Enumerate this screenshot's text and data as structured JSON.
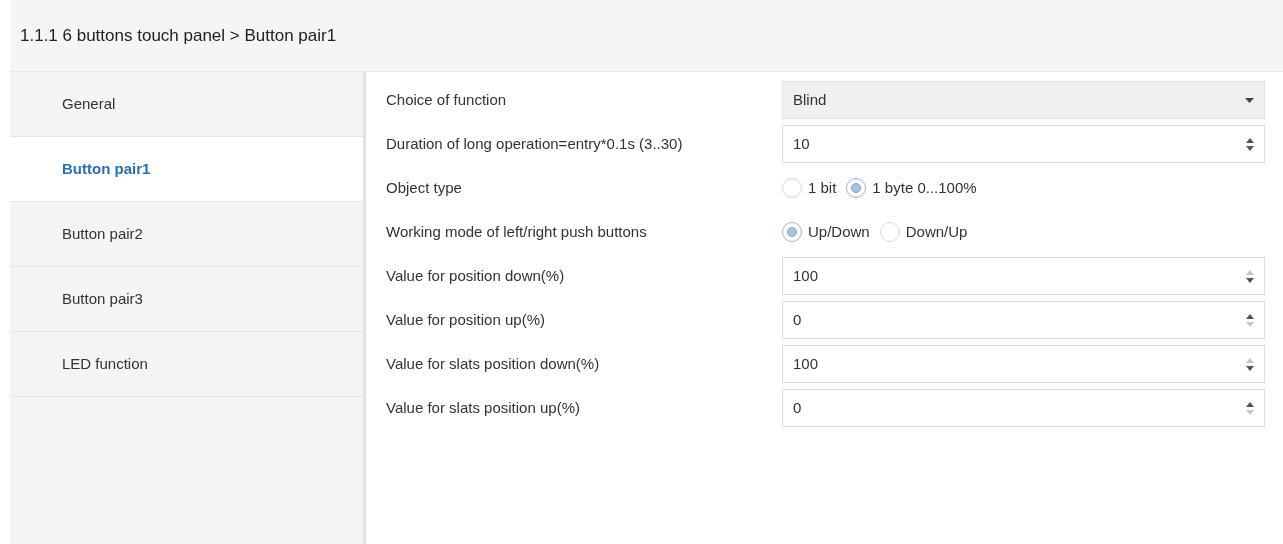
{
  "header": {
    "title": "1.1.1 6 buttons touch panel > Button pair1"
  },
  "sidebar": {
    "items": [
      {
        "label": "General",
        "selected": false
      },
      {
        "label": "Button pair1",
        "selected": true
      },
      {
        "label": "Button pair2",
        "selected": false
      },
      {
        "label": "Button pair3",
        "selected": false
      },
      {
        "label": "LED function",
        "selected": false
      }
    ]
  },
  "parameters": [
    {
      "kind": "dropdown",
      "label": "Choice of function",
      "value": "Blind"
    },
    {
      "kind": "spinner",
      "label": "Duration of long operation=entry*0.1s (3..30)",
      "value": "10",
      "up_disabled": false,
      "down_disabled": false
    },
    {
      "kind": "radio",
      "label": "Object type",
      "options": [
        {
          "label": "1 bit",
          "selected": false
        },
        {
          "label": "1 byte 0...100%",
          "selected": true
        }
      ]
    },
    {
      "kind": "radio",
      "label": "Working mode of left/right push buttons",
      "options": [
        {
          "label": "Up/Down",
          "selected": true
        },
        {
          "label": "Down/Up",
          "selected": false
        }
      ]
    },
    {
      "kind": "spinner",
      "label": "Value for position down(%)",
      "value": "100",
      "up_disabled": true,
      "down_disabled": false
    },
    {
      "kind": "spinner",
      "label": "Value for position up(%)",
      "value": "0",
      "up_disabled": false,
      "down_disabled": true
    },
    {
      "kind": "spinner",
      "label": "Value for slats position down(%)",
      "value": "100",
      "up_disabled": true,
      "down_disabled": false
    },
    {
      "kind": "spinner",
      "label": "Value for slats position up(%)",
      "value": "0",
      "up_disabled": false,
      "down_disabled": true
    }
  ]
}
